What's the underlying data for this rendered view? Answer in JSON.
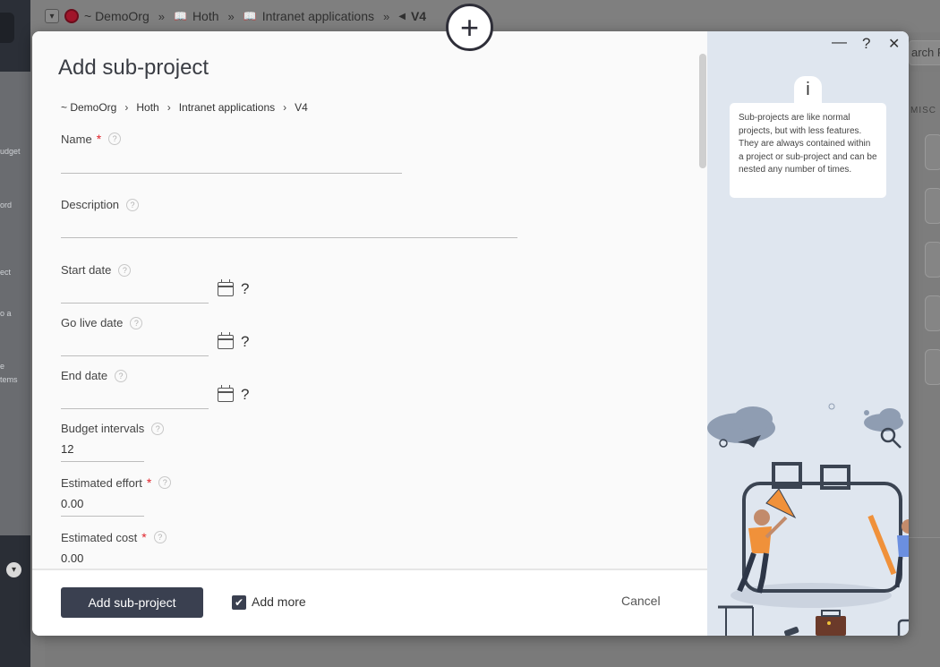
{
  "background": {
    "breadcrumb": {
      "org": "~ DemoOrg",
      "item1": "Hoth",
      "item2": "Intranet applications",
      "current": "V4"
    },
    "search_placeholder": "arch P",
    "misc_label": "MISC",
    "left_labels": [
      "udget",
      "ord",
      "ect",
      "o a",
      "e",
      "tems"
    ]
  },
  "modal": {
    "title": "Add sub-project",
    "breadcrumb": [
      "~ DemoOrg",
      "Hoth",
      "Intranet applications",
      "V4"
    ],
    "fields": {
      "name": {
        "label": "Name",
        "value": ""
      },
      "description": {
        "label": "Description",
        "value": ""
      },
      "start_date": {
        "label": "Start date",
        "value": ""
      },
      "go_live_date": {
        "label": "Go live date",
        "value": ""
      },
      "end_date": {
        "label": "End date",
        "value": ""
      },
      "budget_intervals": {
        "label": "Budget intervals",
        "value": "12"
      },
      "estimated_effort": {
        "label": "Estimated effort",
        "value": "0.00"
      },
      "estimated_cost": {
        "label": "Estimated cost",
        "value": "0.00"
      }
    },
    "date_help": "?",
    "footer": {
      "submit_label": "Add sub-project",
      "add_more_label": "Add more",
      "add_more_checked": true,
      "cancel_label": "Cancel"
    },
    "window_controls": {
      "minimize": "—",
      "help": "?",
      "close": "✕"
    },
    "info": {
      "icon": "i",
      "text": "Sub-projects are like normal projects, but with less features. They are always contained within a project or sub-project and can be nested any number of times."
    }
  },
  "colors": {
    "primary_button": "#3a4050",
    "required": "#e0242c",
    "side_panel": "#dfe6ef",
    "accent_orange": "#f0913a"
  }
}
